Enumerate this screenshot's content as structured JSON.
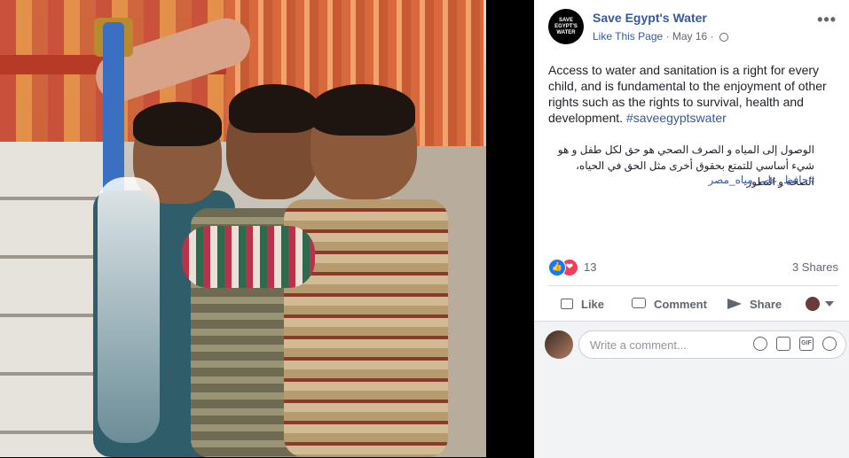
{
  "post": {
    "page_name": "Save Egypt's Water",
    "avatar_text": "SAVE EGYPT'S WATER",
    "like_page": "Like This Page",
    "separator": "·",
    "date": "May 16",
    "body_en": "Access to water and sanitation is a right for every child, and is fundamental to the enjoyment of other rights such as the rights to survival, health and development.",
    "hashtag_en": "#saveegyptswater",
    "body_ar": "الوصول إلى المياه و الصرف الصحي هو حق لكل طفل و هو شيء أساسي للتمتع بحقوق أخرى مثل الحق في الحياه، الصحه و التطور.",
    "hashtag_ar": "#حافظ_على_مياه_مصر",
    "more_icon": "•••"
  },
  "reactions": {
    "count": "13",
    "shares": "3 Shares",
    "like_icon": "👍",
    "love_icon": "❤"
  },
  "actions": {
    "like": "Like",
    "comment": "Comment",
    "share": "Share"
  },
  "comment_box": {
    "placeholder": "Write a comment...",
    "gif_label": "GIF"
  },
  "icons": [
    "more-options-icon",
    "globe-icon",
    "like-reaction-icon",
    "love-reaction-icon",
    "thumbs-up-icon",
    "comment-icon",
    "share-icon",
    "emoji-icon",
    "camera-icon",
    "gif-icon",
    "sticker-icon"
  ]
}
